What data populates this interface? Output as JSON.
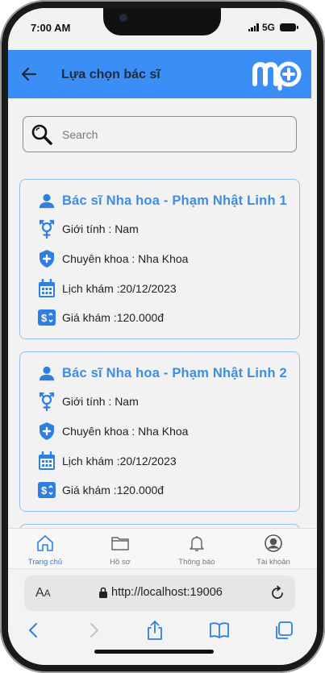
{
  "status_bar": {
    "time": "7:00 AM",
    "network": "5G"
  },
  "header": {
    "title": "Lựa chọn bác sĩ"
  },
  "search": {
    "placeholder": "Search"
  },
  "doctors": [
    {
      "name": "Bác sĩ Nha hoa - Phạm Nhật Linh 1",
      "gender": "Giới tính : Nam",
      "specialty": "Chuyên khoa : Nha Khoa",
      "schedule": "Lịch khám :20/12/2023",
      "price": "Giá khám :120.000đ"
    },
    {
      "name": "Bác sĩ Nha hoa - Phạm Nhật Linh 2",
      "gender": "Giới tính : Nam",
      "specialty": "Chuyên khoa : Nha Khoa",
      "schedule": "Lịch khám :20/12/2023",
      "price": "Giá khám :120.000đ"
    }
  ],
  "tabs": [
    {
      "label": "Trang chủ",
      "icon": "home-icon",
      "active": true
    },
    {
      "label": "Hồ sơ",
      "icon": "folder-icon",
      "active": false
    },
    {
      "label": "Thông báo",
      "icon": "bell-icon",
      "active": false
    },
    {
      "label": "Tài khoản",
      "icon": "account-icon",
      "active": false
    }
  ],
  "browser": {
    "text_size_label_small": "A",
    "text_size_label_large": "A",
    "url": "http://localhost:19006"
  },
  "colors": {
    "accent": "#3b8ef6",
    "card_border": "#8fbfee",
    "name_text": "#3b8ee6",
    "icon": "#2f7fe3"
  }
}
